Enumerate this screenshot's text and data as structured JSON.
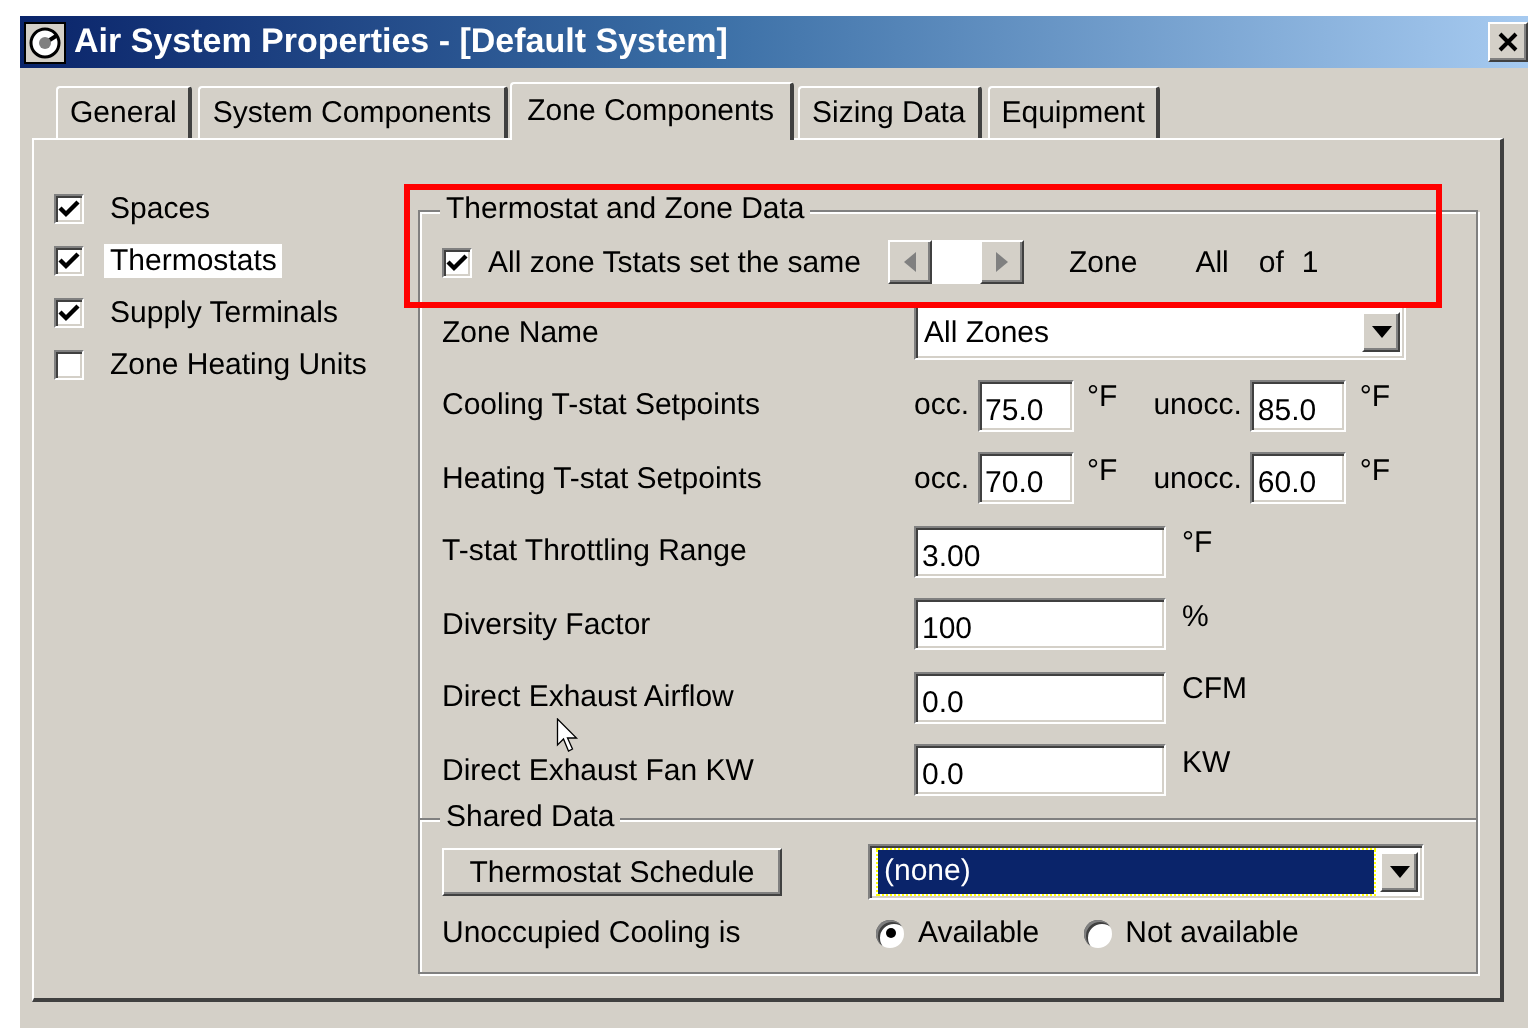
{
  "window": {
    "title": "Air System Properties - [Default System]"
  },
  "tabs": [
    {
      "label": "General",
      "selected": false
    },
    {
      "label": "System Components",
      "selected": false
    },
    {
      "label": "Zone Components",
      "selected": true
    },
    {
      "label": "Sizing Data",
      "selected": false
    },
    {
      "label": "Equipment",
      "selected": false
    }
  ],
  "components": [
    {
      "label": "Spaces",
      "checked": true,
      "selected": false
    },
    {
      "label": "Thermostats",
      "checked": true,
      "selected": true
    },
    {
      "label": "Supply Terminals",
      "checked": true,
      "selected": false
    },
    {
      "label": "Zone Heating Units",
      "checked": false,
      "selected": false
    }
  ],
  "thermostat_group": {
    "title": "Thermostat and Zone Data",
    "all_same": {
      "label": "All zone Tstats set the same",
      "checked": true
    },
    "zone_nav": {
      "label": "Zone",
      "value": "All",
      "of": "of",
      "count": "1"
    },
    "zone_name": {
      "label": "Zone Name",
      "value": "All Zones"
    },
    "setpoints": [
      {
        "label": "Cooling T-stat Setpoints",
        "occ_label": "occ.",
        "occ": "75.0",
        "occ_unit": "°F",
        "unocc_label": "unocc.",
        "unocc": "85.0",
        "unocc_unit": "°F"
      },
      {
        "label": "Heating T-stat Setpoints",
        "occ_label": "occ.",
        "occ": "70.0",
        "occ_unit": "°F",
        "unocc_label": "unocc.",
        "unocc": "60.0",
        "unocc_unit": "°F"
      }
    ],
    "fields": [
      {
        "label": "T-stat Throttling Range",
        "value": "3.00",
        "unit": "°F"
      },
      {
        "label": "Diversity Factor",
        "value": "100",
        "unit": "%"
      },
      {
        "label": "Direct Exhaust Airflow",
        "value": "0.0",
        "unit": "CFM"
      },
      {
        "label": "Direct Exhaust Fan KW",
        "value": "0.0",
        "unit": "KW"
      }
    ]
  },
  "shared": {
    "title": "Shared Data",
    "schedule_button": "Thermostat Schedule",
    "schedule": "(none)",
    "cooling_label": "Unoccupied Cooling is",
    "options": [
      {
        "label": "Available",
        "selected": true
      },
      {
        "label": "Not available",
        "selected": false
      }
    ]
  }
}
